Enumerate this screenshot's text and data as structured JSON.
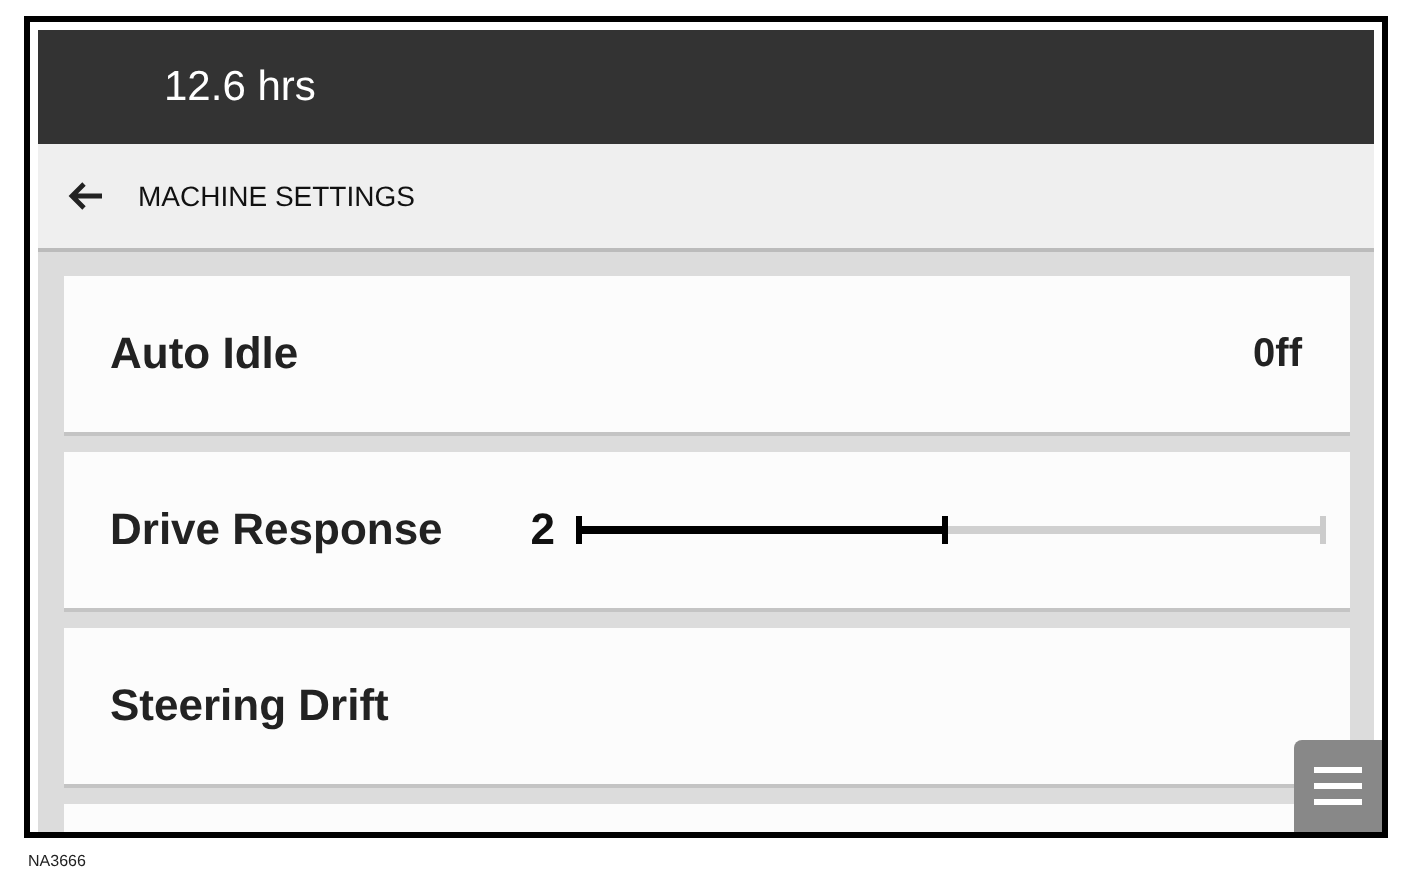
{
  "status_bar": {
    "hours": "12.6 hrs"
  },
  "header": {
    "title": "MACHINE SETTINGS"
  },
  "settings": [
    {
      "kind": "value",
      "label": "Auto Idle",
      "value": "0ff"
    },
    {
      "kind": "slider",
      "label": "Drive Response",
      "reading": "2",
      "level": 0.5
    },
    {
      "kind": "plain",
      "label": "Steering Drift"
    },
    {
      "kind": "empty"
    }
  ],
  "figure_label": "NA3666"
}
